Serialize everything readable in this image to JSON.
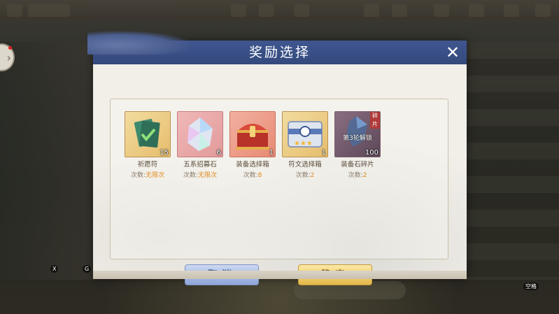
{
  "dialog": {
    "title": "奖励选择",
    "items": [
      {
        "name": "祈愿符",
        "count": "15",
        "times_label": "次数:",
        "times_value": "无限次",
        "icon": "green-talisman-icon"
      },
      {
        "name": "五系招募石",
        "count": "6",
        "times_label": "次数:",
        "times_value": "无限次",
        "icon": "crystal-stone-icon"
      },
      {
        "name": "装备选择箱",
        "count": "1",
        "times_label": "次数:",
        "times_value": "8",
        "icon": "red-treasure-chest-icon"
      },
      {
        "name": "符文选择箱",
        "count": "1",
        "times_label": "次数:",
        "times_value": "2",
        "icon": "silver-rune-chest-icon"
      },
      {
        "name": "装备石碎片",
        "count": "100",
        "times_label": "次数:",
        "times_value": "2",
        "icon": "equipment-stone-shard-icon",
        "shard_tag": "碎片",
        "overlay": "第3轮解锁"
      }
    ],
    "cancel_label": "取消",
    "confirm_label": "确定"
  },
  "hud": {
    "key_x": "X",
    "key_g": "G",
    "key_space": "空格"
  },
  "colors": {
    "header": "#3f5690",
    "highlight": "#e08a1e",
    "confirm": "#f1cf6a",
    "cancel": "#a4b9e6"
  }
}
